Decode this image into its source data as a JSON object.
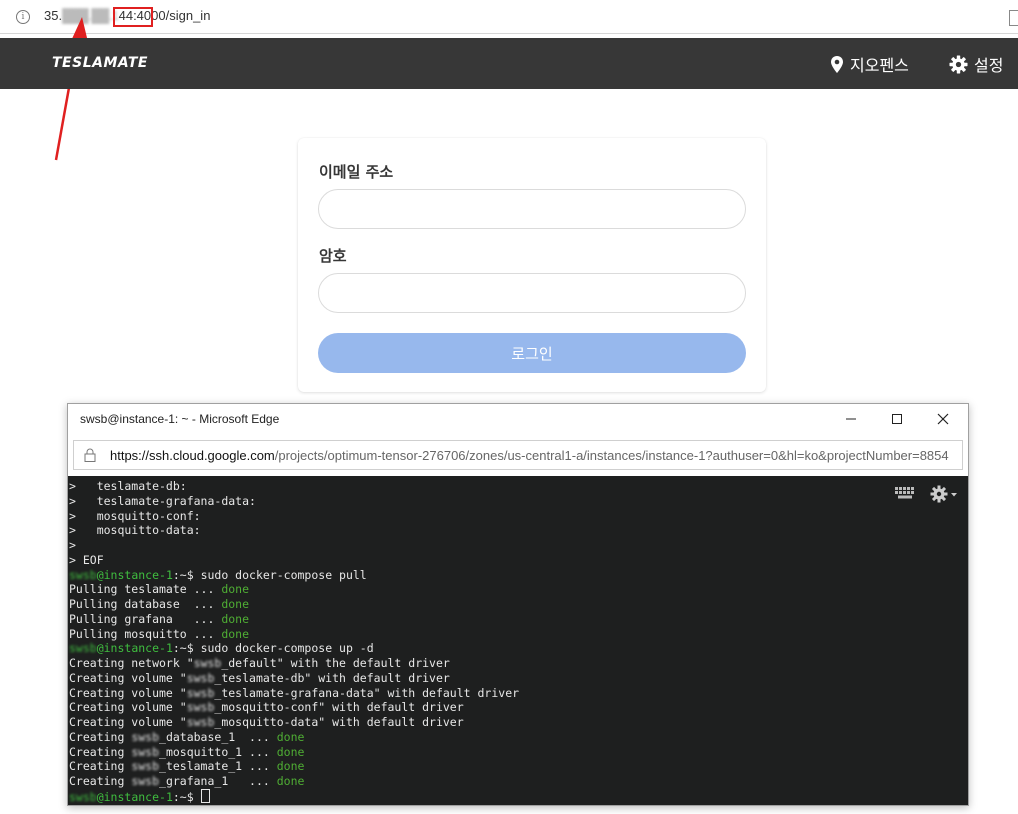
{
  "address_bar": {
    "url_prefix": "35.",
    "url_blurred": "███.██.1",
    "url_suffix": "44",
    "url_port": ":4000",
    "url_path": "/sign_in",
    "info_icon": "info-icon"
  },
  "app": {
    "brand": "TESLAMATE",
    "nav": {
      "geofences": "지오펜스",
      "settings": "설정"
    }
  },
  "login": {
    "email_label": "이메일 주소",
    "email_value": "",
    "password_label": "암호",
    "password_value": "",
    "submit": "로그인"
  },
  "edge_window": {
    "title": "swsb@instance-1: ~ - Microsoft Edge",
    "url_host": "https://ssh.cloud.google.com",
    "url_path": "/projects/optimum-tensor-276706/zones/us-central1-a/instances/instance-1?authuser=0&hl=ko&projectNumber=8854"
  },
  "terminal": {
    "lines": [
      [
        {
          "t": ">   teslamate-db:"
        }
      ],
      [
        {
          "t": ">   teslamate-grafana-data:"
        }
      ],
      [
        {
          "t": ">   mosquitto-conf:"
        }
      ],
      [
        {
          "t": ">   mosquitto-data:"
        }
      ],
      [
        {
          "t": ">"
        }
      ],
      [
        {
          "t": "> EOF"
        }
      ],
      [
        {
          "t": "swsb",
          "c": "g bl"
        },
        {
          "t": "@instance-1",
          "c": "g"
        },
        {
          "t": ":~$ sudo docker-compose pull"
        }
      ],
      [
        {
          "t": "Pulling teslamate ... "
        },
        {
          "t": "done",
          "c": "d"
        }
      ],
      [
        {
          "t": "Pulling database  ... "
        },
        {
          "t": "done",
          "c": "d"
        }
      ],
      [
        {
          "t": "Pulling grafana   ... "
        },
        {
          "t": "done",
          "c": "d"
        }
      ],
      [
        {
          "t": "Pulling mosquitto ... "
        },
        {
          "t": "done",
          "c": "d"
        }
      ],
      [
        {
          "t": "swsb",
          "c": "g bl"
        },
        {
          "t": "@instance-1",
          "c": "g"
        },
        {
          "t": ":~$ sudo docker-compose up -d"
        }
      ],
      [
        {
          "t": "Creating network \""
        },
        {
          "t": "swsb",
          "c": "bl"
        },
        {
          "t": "_default\" with the default driver"
        }
      ],
      [
        {
          "t": "Creating volume \""
        },
        {
          "t": "swsb",
          "c": "bl"
        },
        {
          "t": "_teslamate-db\" with default driver"
        }
      ],
      [
        {
          "t": "Creating volume \""
        },
        {
          "t": "swsb",
          "c": "bl"
        },
        {
          "t": "_teslamate-grafana-data\" with default driver"
        }
      ],
      [
        {
          "t": "Creating volume \""
        },
        {
          "t": "swsb",
          "c": "bl"
        },
        {
          "t": "_mosquitto-conf\" with default driver"
        }
      ],
      [
        {
          "t": "Creating volume \""
        },
        {
          "t": "swsb",
          "c": "bl"
        },
        {
          "t": "_mosquitto-data\" with default driver"
        }
      ],
      [
        {
          "t": "Creating "
        },
        {
          "t": "swsb",
          "c": "bl"
        },
        {
          "t": "_database_1  ... "
        },
        {
          "t": "done",
          "c": "d"
        }
      ],
      [
        {
          "t": "Creating "
        },
        {
          "t": "swsb",
          "c": "bl"
        },
        {
          "t": "_mosquitto_1 ... "
        },
        {
          "t": "done",
          "c": "d"
        }
      ],
      [
        {
          "t": "Creating "
        },
        {
          "t": "swsb",
          "c": "bl"
        },
        {
          "t": "_teslamate_1 ... "
        },
        {
          "t": "done",
          "c": "d"
        }
      ],
      [
        {
          "t": "Creating "
        },
        {
          "t": "swsb",
          "c": "bl"
        },
        {
          "t": "_grafana_1   ... "
        },
        {
          "t": "done",
          "c": "d"
        }
      ],
      [
        {
          "t": "swsb",
          "c": "g bl"
        },
        {
          "t": "@instance-1",
          "c": "g"
        },
        {
          "t": ":~$ "
        },
        {
          "t": "",
          "c": "cursor"
        }
      ]
    ]
  },
  "colors": {
    "navbar": "#373737",
    "login_button": "#97b8ed",
    "terminal_bg": "#1e1f1f",
    "prompt_green": "#3fbd3f",
    "highlight_red": "#e02020"
  }
}
